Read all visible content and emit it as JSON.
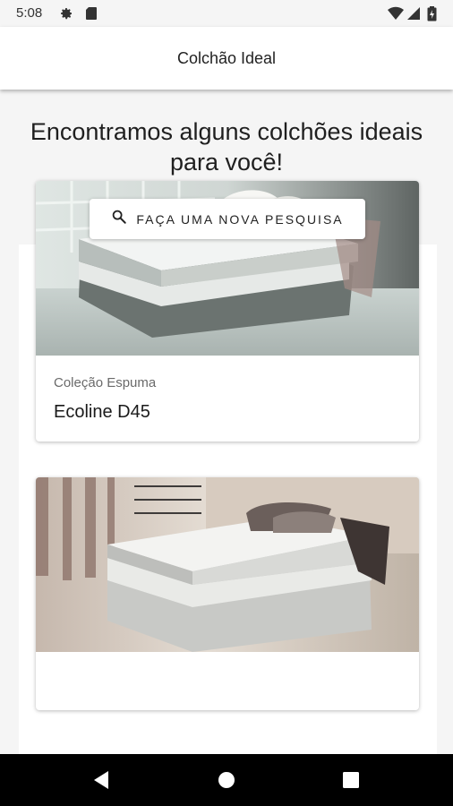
{
  "status_bar": {
    "time": "5:08",
    "icons": [
      "settings-icon",
      "sd-card-icon",
      "wifi-icon",
      "signal-icon",
      "battery-icon"
    ]
  },
  "app_bar": {
    "title": "Colchão Ideal"
  },
  "main": {
    "headline": "Encontramos alguns colchões ideais para você!",
    "search_button": {
      "label": "FAÇA UMA NOVA PESQUISA",
      "icon": "search-icon"
    }
  },
  "products": [
    {
      "collection": "Coleção Espuma",
      "name": "Ecoline D45"
    },
    {
      "collection": "",
      "name": ""
    }
  ],
  "nav_bar": {
    "buttons": [
      "back-icon",
      "home-icon",
      "recents-icon"
    ]
  },
  "colors": {
    "background": "#f5f5f5",
    "app_bar": "#ffffff",
    "nav_bar": "#000000"
  }
}
